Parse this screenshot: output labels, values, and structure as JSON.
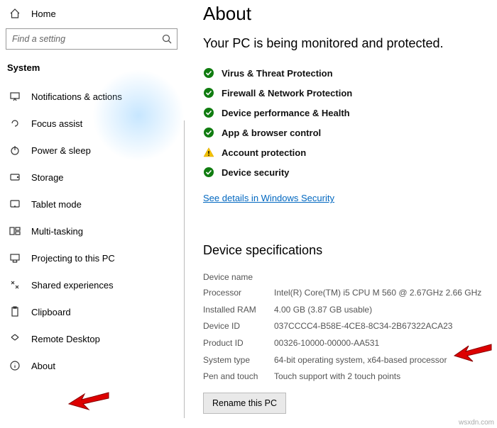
{
  "sidebar": {
    "home_label": "Home",
    "search_placeholder": "Find a setting",
    "category": "System",
    "items": [
      {
        "label": "Notifications & actions"
      },
      {
        "label": "Focus assist"
      },
      {
        "label": "Power & sleep"
      },
      {
        "label": "Storage"
      },
      {
        "label": "Tablet mode"
      },
      {
        "label": "Multi-tasking"
      },
      {
        "label": "Projecting to this PC"
      },
      {
        "label": "Shared experiences"
      },
      {
        "label": "Clipboard"
      },
      {
        "label": "Remote Desktop"
      },
      {
        "label": "About"
      }
    ]
  },
  "main": {
    "title": "About",
    "protection_heading": "Your PC is being monitored and protected.",
    "status": [
      {
        "label": "Virus & Threat Protection",
        "icon": "check"
      },
      {
        "label": "Firewall & Network Protection",
        "icon": "check"
      },
      {
        "label": "Device performance & Health",
        "icon": "check"
      },
      {
        "label": "App & browser control",
        "icon": "check"
      },
      {
        "label": "Account protection",
        "icon": "warn"
      },
      {
        "label": "Device security",
        "icon": "check"
      }
    ],
    "details_link": "See details in Windows Security",
    "specs_heading": "Device specifications",
    "specs": {
      "device_name_label": "Device name",
      "device_name_value": "",
      "processor_label": "Processor",
      "processor_value": "Intel(R) Core(TM) i5 CPU       M 560  @ 2.67GHz   2.66 GHz",
      "ram_label": "Installed RAM",
      "ram_value": "4.00 GB (3.87 GB usable)",
      "device_id_label": "Device ID",
      "device_id_value": "037CCCC4-B58E-4CE8-8C34-2B67322ACA23",
      "product_id_label": "Product ID",
      "product_id_value": "00326-10000-00000-AA531",
      "system_type_label": "System type",
      "system_type_value": "64-bit operating system, x64-based processor",
      "pen_touch_label": "Pen and touch",
      "pen_touch_value": "Touch support with 2 touch points"
    },
    "rename_button": "Rename this PC"
  }
}
